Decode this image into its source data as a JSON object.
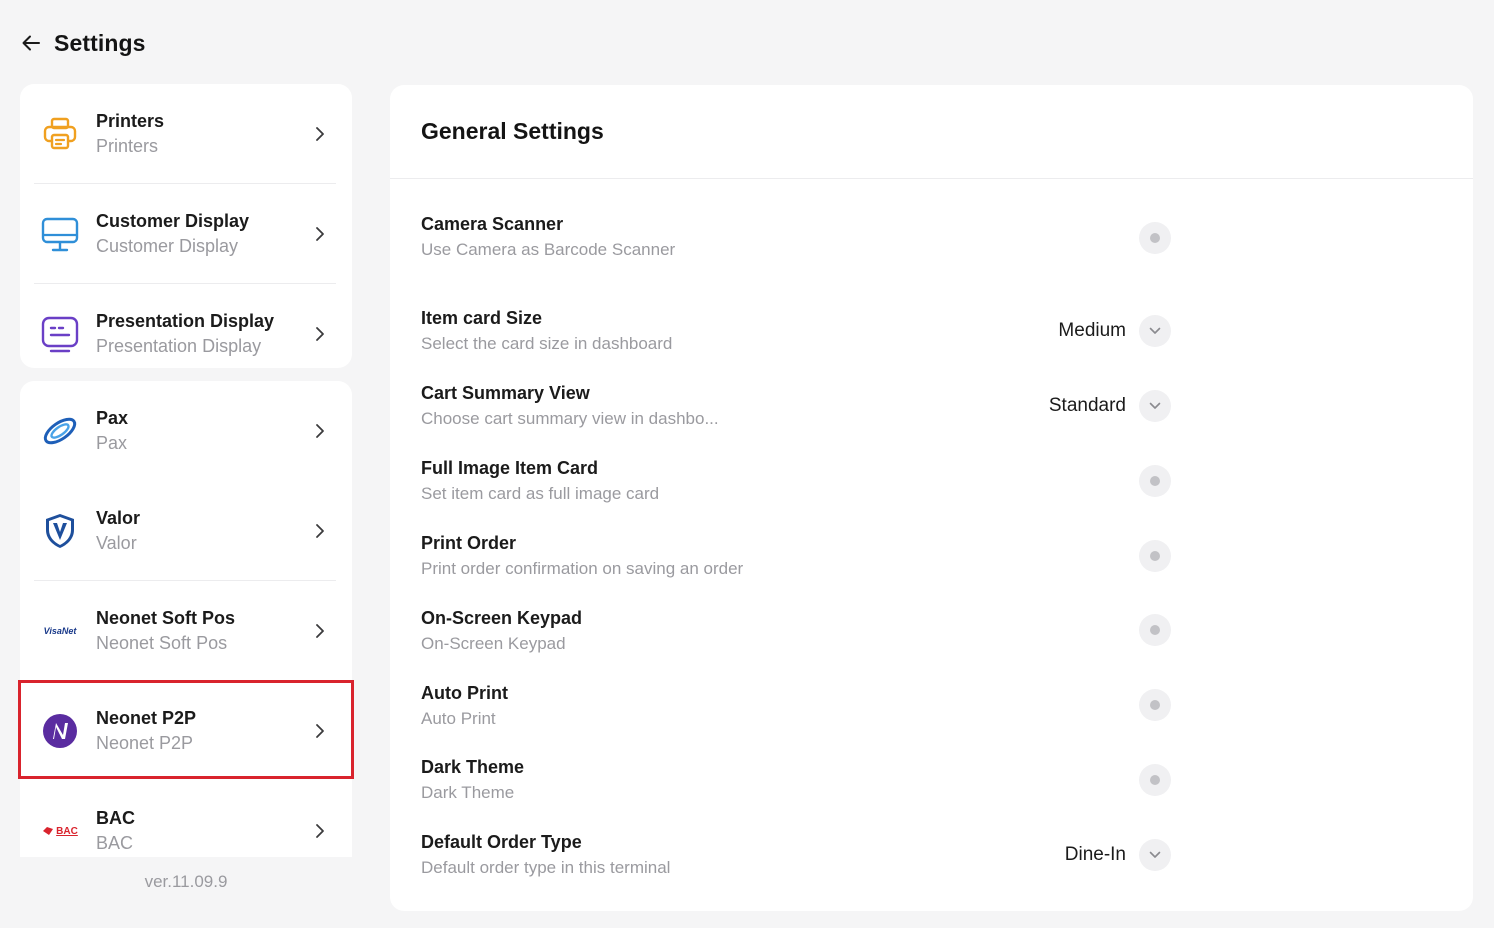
{
  "header": {
    "title": "Settings"
  },
  "sidebar": {
    "group1": [
      {
        "title": "Printers",
        "subtitle": "Printers"
      },
      {
        "title": "Customer Display",
        "subtitle": "Customer Display"
      },
      {
        "title": "Presentation Display",
        "subtitle": "Presentation Display"
      }
    ],
    "group2": [
      {
        "title": "Pax",
        "subtitle": "Pax"
      },
      {
        "title": "Valor",
        "subtitle": "Valor"
      },
      {
        "title": "Neonet Soft Pos",
        "subtitle": "Neonet Soft Pos",
        "logo_text": "VisaNet"
      },
      {
        "title": "Neonet P2P",
        "subtitle": "Neonet P2P"
      },
      {
        "title": "BAC",
        "subtitle": "BAC",
        "logo_text": "BAC"
      }
    ],
    "version": "ver.11.09.9"
  },
  "panel": {
    "title": "General Settings",
    "settings": [
      {
        "title": "Camera Scanner",
        "subtitle": "Use Camera as Barcode Scanner",
        "control": "toggle"
      },
      {
        "title": "Item card Size",
        "subtitle": "Select the card size in dashboard",
        "control": "select",
        "value": "Medium"
      },
      {
        "title": "Cart Summary View",
        "subtitle": "Choose cart summary view in dashbo...",
        "control": "select",
        "value": "Standard"
      },
      {
        "title": "Full Image Item Card",
        "subtitle": "Set item card as full image card",
        "control": "toggle"
      },
      {
        "title": "Print Order",
        "subtitle": "Print order confirmation on saving an order",
        "control": "toggle"
      },
      {
        "title": "On-Screen Keypad",
        "subtitle": "On-Screen Keypad",
        "control": "toggle"
      },
      {
        "title": "Auto Print",
        "subtitle": "Auto Print",
        "control": "toggle"
      },
      {
        "title": "Dark Theme",
        "subtitle": "Dark Theme",
        "control": "toggle"
      },
      {
        "title": "Default Order Type",
        "subtitle": "Default order type in this terminal",
        "control": "select",
        "value": "Dine-In"
      }
    ]
  },
  "colors": {
    "highlight": "#d9232d",
    "printer_icon": "#f0a020",
    "display_icon": "#2f8fd8",
    "presentation_icon": "#6a3fc6",
    "neonet_icon": "#5a2ca0"
  }
}
